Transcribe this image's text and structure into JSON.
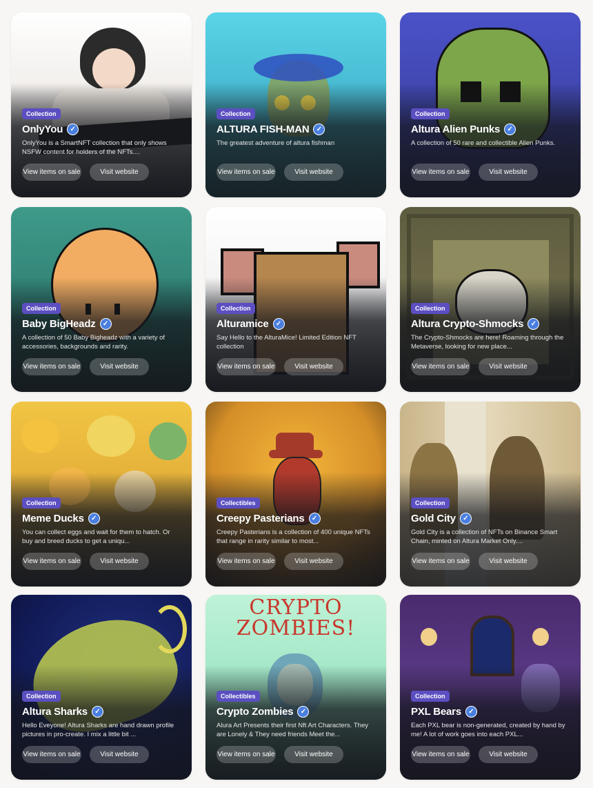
{
  "actions": {
    "view_sale": "View items on sale",
    "visit": "Visit website"
  },
  "cards": [
    {
      "badge": "Collection",
      "title": "OnlyYou",
      "desc": "OnlyYou is a SmartNFT collection that only shows NSFW content for holders of the NFTs....",
      "art": "anime-girl-illustration"
    },
    {
      "badge": "Collection",
      "title": "ALTURA FISH-MAN",
      "desc": "The greatest adventure of altura fishman",
      "art": "fishman-illustration"
    },
    {
      "badge": "Collection",
      "title": "Altura Alien Punks",
      "desc": "A collection of 50 rare and collectible Alien Punks.",
      "art": "pixel-alien"
    },
    {
      "badge": "Collection",
      "title": "Baby BigHeadz",
      "desc": "A collection of 50 Baby Bigheadz with a variety of accessories, backgrounds and rarity.",
      "art": "pixel-bighead"
    },
    {
      "badge": "Collection",
      "title": "Alturamice",
      "desc": "Say Hello to the AlturaMice! Limited Edition NFT collection",
      "art": "pixel-mouse"
    },
    {
      "badge": "Collection",
      "title": "Altura Crypto-Shmocks",
      "desc": "The Crypto-Shmocks are here! Roaming through the Metaverse, looking for new place...",
      "art": "pixel-shmock"
    },
    {
      "badge": "Collection",
      "title": "Meme Ducks",
      "desc": "You can collect eggs and wait for them to hatch. Or buy and breed ducks to get a uniqu...",
      "art": "meme-ducks-collage"
    },
    {
      "badge": "Collectibles",
      "title": "Creepy Pasterians",
      "desc": "Creepy Pasterians is a collection of 400 unique NFTs that range in rarity similar to most...",
      "art": "creepy-character"
    },
    {
      "badge": "Collection",
      "title": "Gold City",
      "desc": "Gold City is a collection of NFTs on Binance Smart Chain, minted on Altura Market Only....",
      "art": "gold-sculptures"
    },
    {
      "badge": "Collection",
      "title": "Altura Sharks",
      "desc": "Hello Eveyone! Altura Sharks are hand drawn profile pictures in pro-create. I mix a little bit ...",
      "art": "shark-illustration"
    },
    {
      "badge": "Collectibles",
      "title": "Crypto Zombies",
      "desc": "Alura Art Presents their first Nft Art Characters. They are Lonely & They need friends Meet the...",
      "art": "zombie-girl",
      "banner": "CRYPTO ZOMBIES!"
    },
    {
      "badge": "Collection",
      "title": "PXL Bears",
      "desc": "Each PXL bear is non-generated, created by hand by me! A lot of work goes into each PXL...",
      "art": "pixel-bear-room"
    }
  ]
}
